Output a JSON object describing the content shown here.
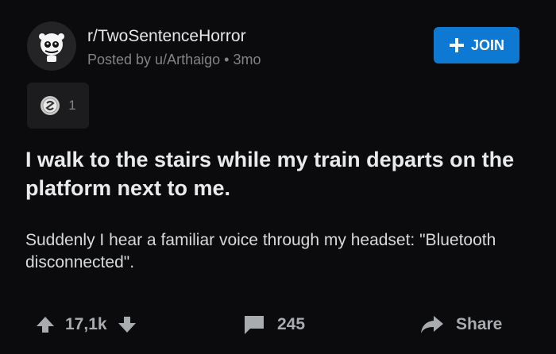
{
  "post": {
    "subreddit": "r/TwoSentenceHorror",
    "posted_by": "Posted by u/Arthaigo",
    "separator": "•",
    "age": "3mo",
    "join_label": "JOIN",
    "award_count": "1",
    "title": "I walk to the stairs while my train departs on the platform next to me.",
    "body": "Suddenly I hear a familiar voice through my headset: \"Bluetooth disconnected\"."
  },
  "footer": {
    "votes": "17,1k",
    "comments": "245",
    "share_label": "Share"
  },
  "icons": {
    "avatar": "subreddit-avatar-icon",
    "join": "plus-icon",
    "award": "silver-award-icon",
    "upvote": "upvote-arrow-icon",
    "downvote": "downvote-arrow-icon",
    "comment": "comment-bubble-icon",
    "share": "share-arrow-icon"
  },
  "colors": {
    "background": "#0b0b0d",
    "join_button": "#0d79d3",
    "text": "#d7dadc",
    "muted": "#818384"
  }
}
